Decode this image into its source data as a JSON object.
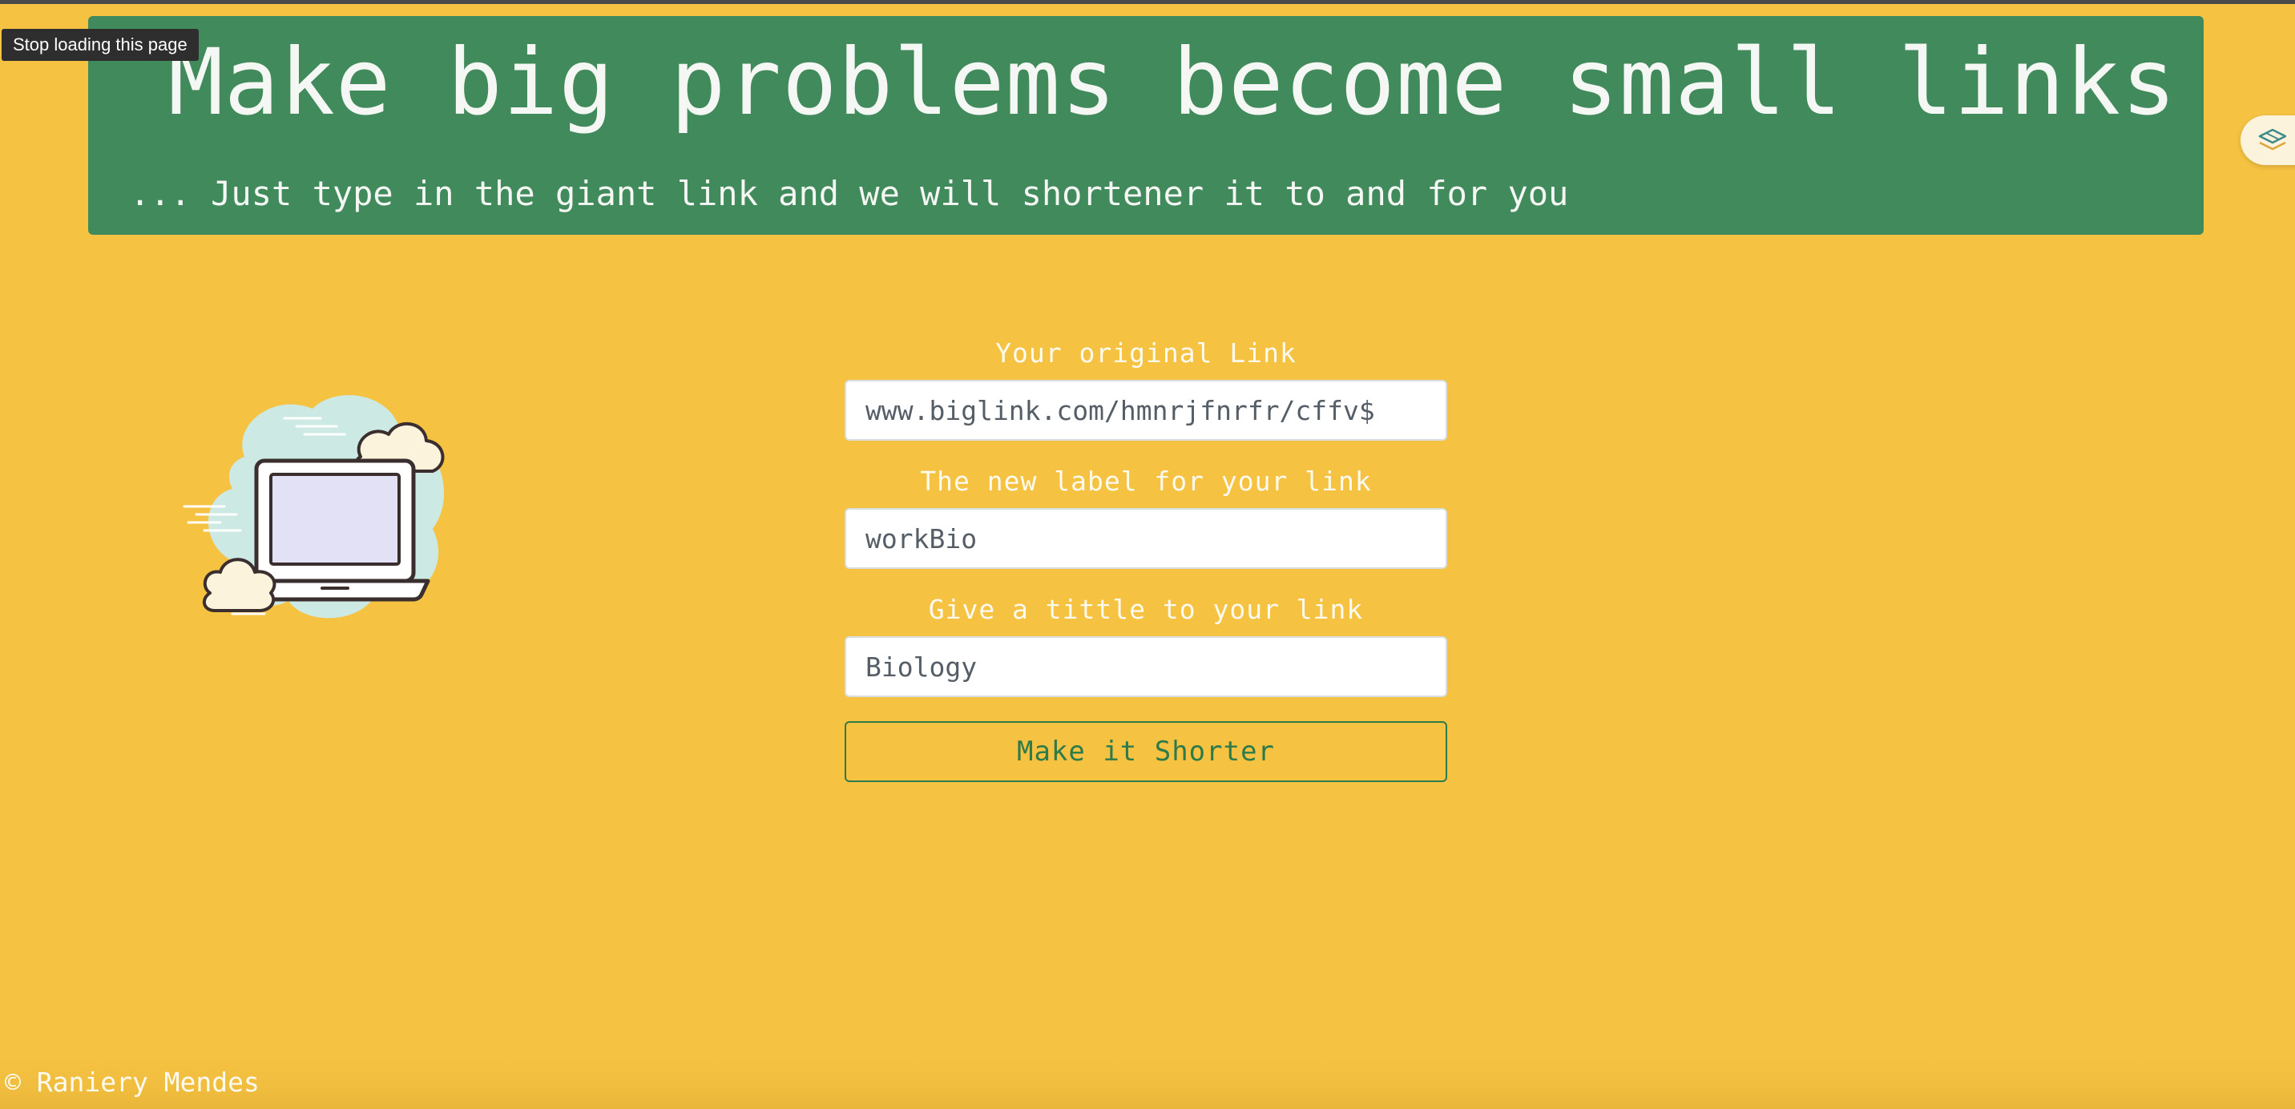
{
  "browser": {
    "tooltip": "Stop loading this page"
  },
  "hero": {
    "title": "Make big problems become small links",
    "subtitle": "... Just type in the giant link and we will shortener it to and for you"
  },
  "form": {
    "original_link": {
      "label": "Your original Link",
      "value": "www.biglink.com/hmnrjfnrfr/cffv$"
    },
    "new_label": {
      "label": "The new label for your link",
      "value": "workBio"
    },
    "title": {
      "label": "Give a tittle to your link",
      "value": "Biology"
    },
    "submit_label": "Make it Shorter"
  },
  "footer": {
    "text": "© Raniery Mendes"
  },
  "colors": {
    "background": "#f5c242",
    "hero": "#418a5b",
    "button_accent": "#2d7a4a"
  },
  "icons": {
    "illustration": "laptop-cloud-illustration",
    "extension": "extension-icon"
  }
}
